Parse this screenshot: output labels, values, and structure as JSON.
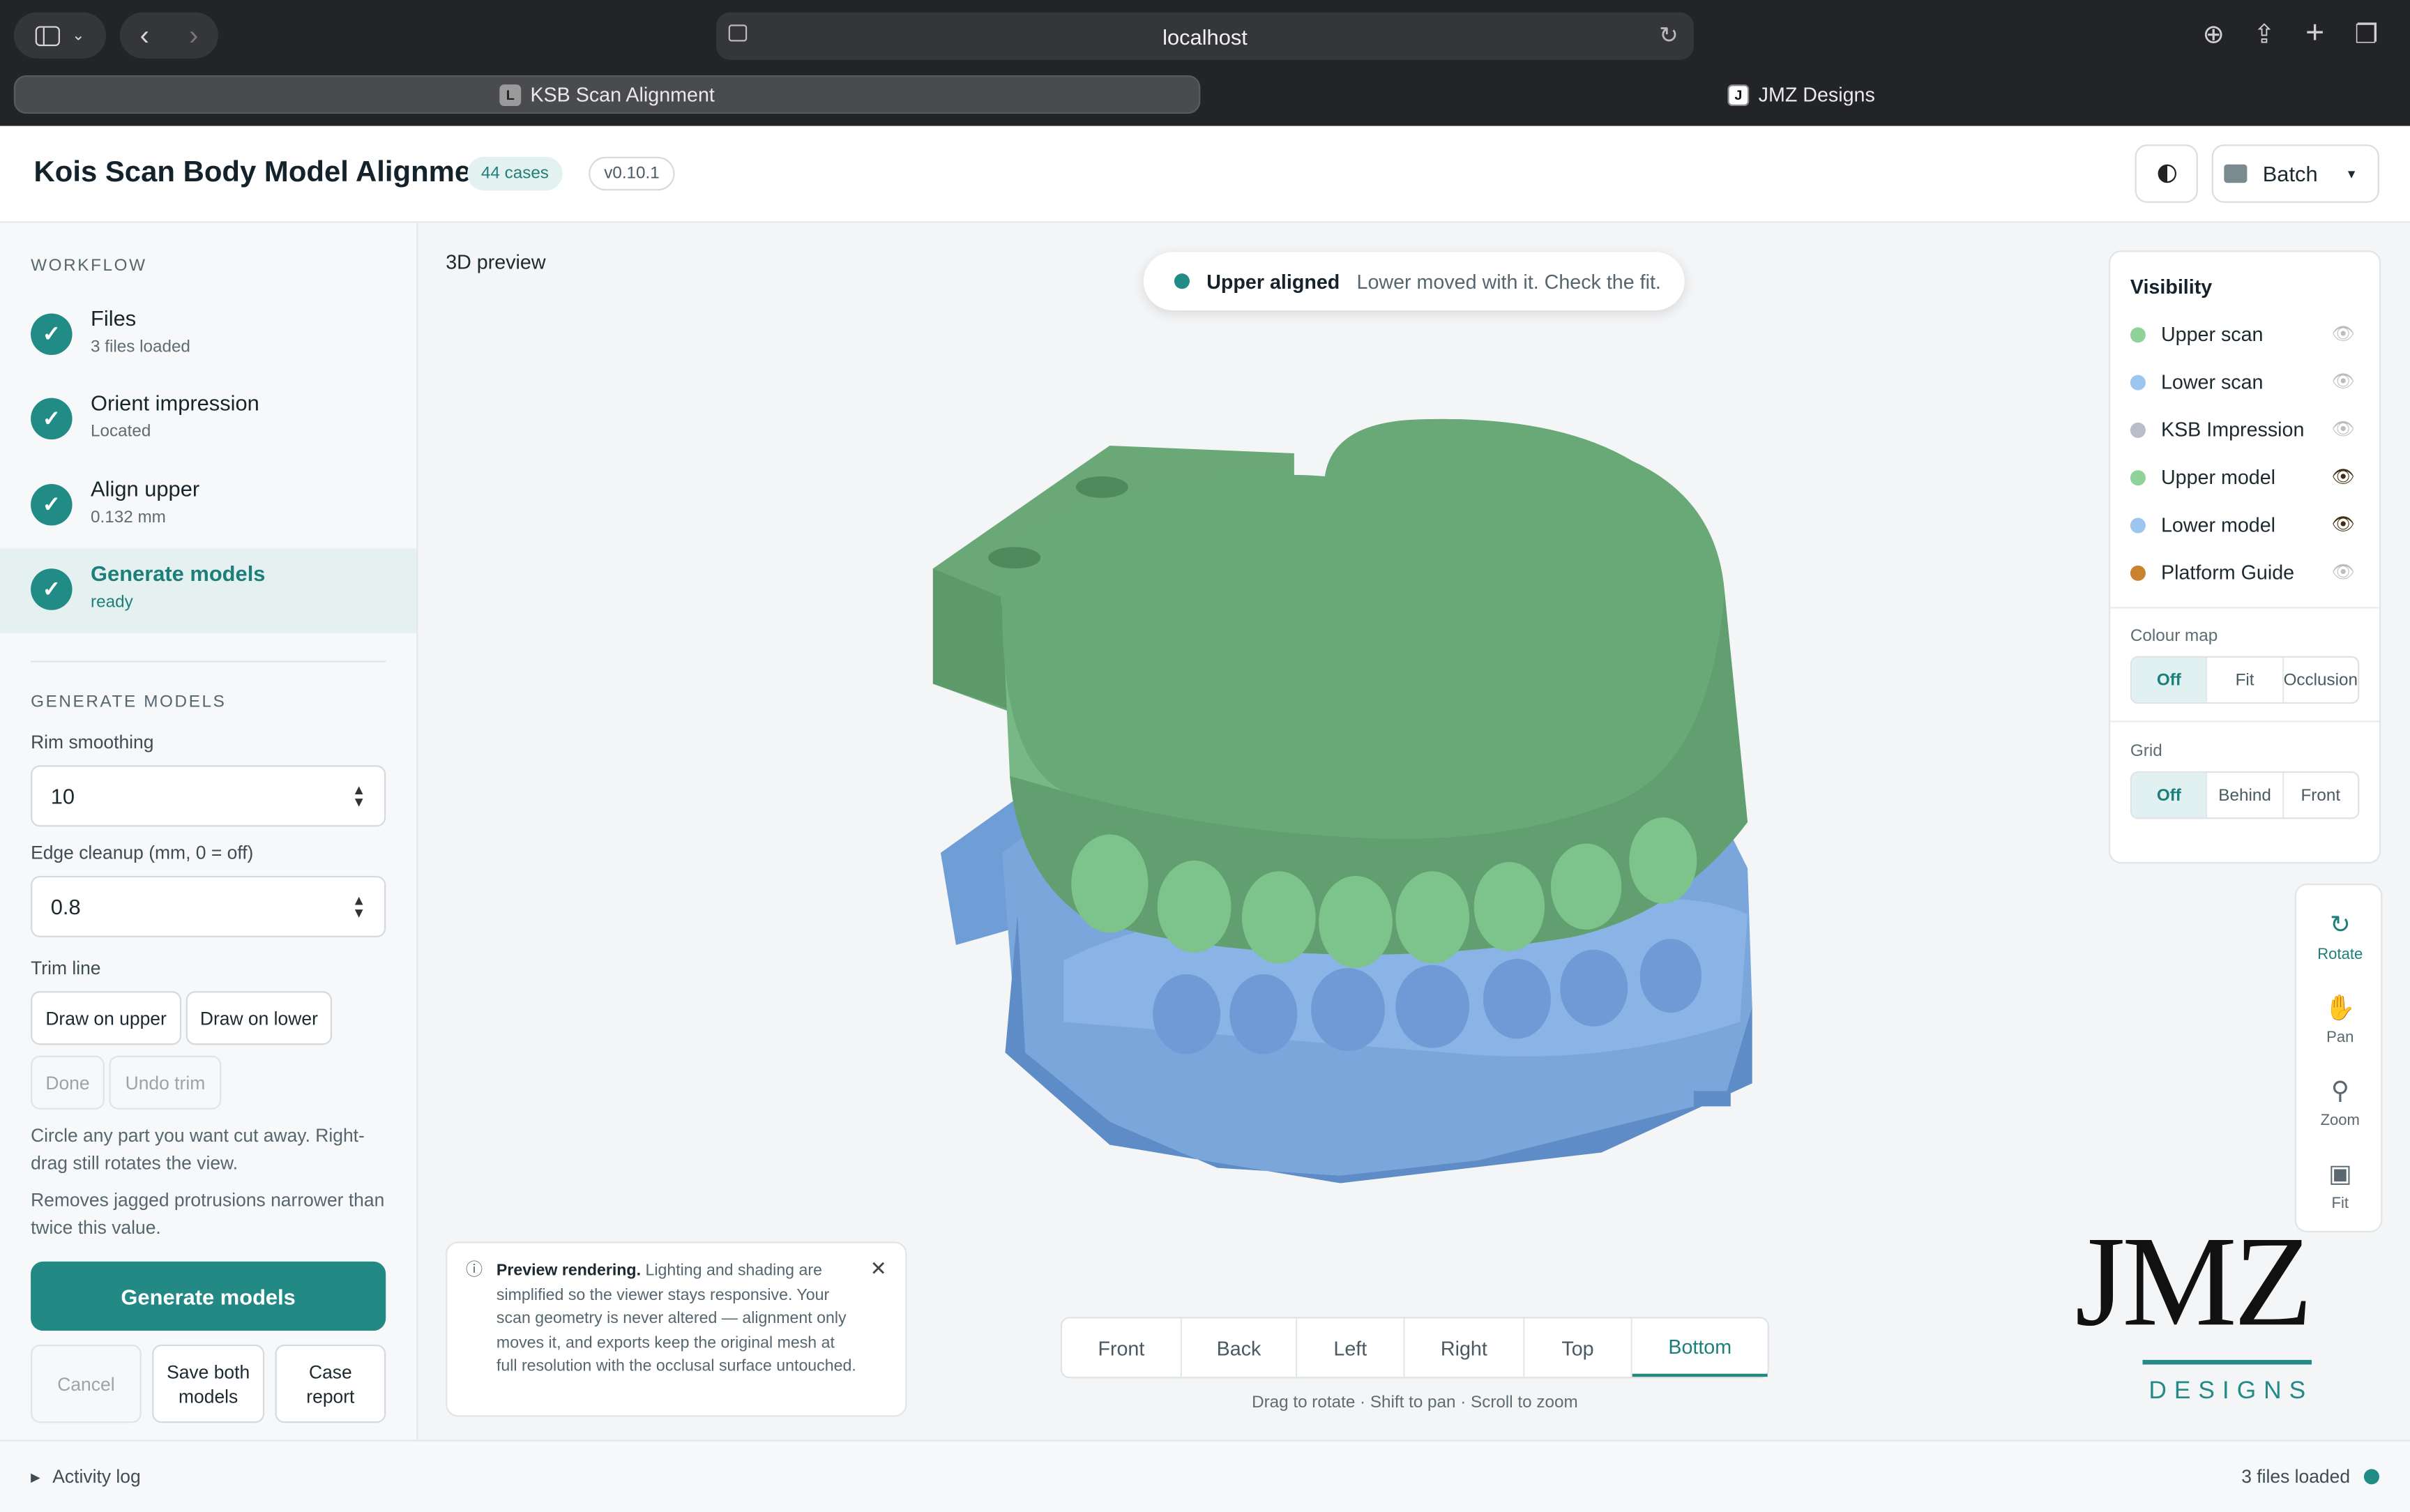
{
  "browser": {
    "url": "localhost",
    "tabs": [
      {
        "label": "KSB Scan Alignment",
        "favicon": "L",
        "active": true
      },
      {
        "label": "JMZ Designs",
        "favicon": "J",
        "active": false
      }
    ]
  },
  "header": {
    "title": "Kois Scan Body Model Alignment",
    "cases_badge": "44 cases",
    "version_badge": "v0.10.1",
    "theme_toggle_icon": "contrast-icon",
    "batch_label": "Batch"
  },
  "sidebar": {
    "workflow_heading": "WORKFLOW",
    "steps": [
      {
        "title": "Files",
        "subtitle": "3 files loaded",
        "done": true
      },
      {
        "title": "Orient impression",
        "subtitle": "Located",
        "done": true
      },
      {
        "title": "Align upper",
        "subtitle": "0.132 mm",
        "done": true
      },
      {
        "title": "Generate models",
        "subtitle": "ready",
        "done": true,
        "active": true
      }
    ],
    "generate_heading": "GENERATE MODELS",
    "rim_smoothing_label": "Rim smoothing",
    "rim_smoothing_value": "10",
    "edge_cleanup_label": "Edge cleanup (mm, 0 = off)",
    "edge_cleanup_value": "0.8",
    "trim_line_label": "Trim line",
    "draw_upper": "Draw on upper",
    "draw_lower": "Draw on lower",
    "done": "Done",
    "undo_trim": "Undo trim",
    "trim_help": "Circle any part you want cut away. Right-drag still rotates the view.",
    "edge_help": "Removes jagged protrusions narrower than twice this value.",
    "generate_button": "Generate models",
    "cancel": "Cancel",
    "save_both": "Save both models",
    "case_report": "Case report"
  },
  "viewer": {
    "label": "3D preview",
    "toast_title": "Upper aligned",
    "toast_text": "Lower moved with it. Check the fit.",
    "visibility_heading": "Visibility",
    "layers": [
      {
        "label": "Upper scan",
        "color": "#8fd39a",
        "visible": false
      },
      {
        "label": "Lower scan",
        "color": "#9cc6f0",
        "visible": false
      },
      {
        "label": "KSB Impression",
        "color": "#b8bdc9",
        "visible": false
      },
      {
        "label": "Upper model",
        "color": "#8fd39a",
        "visible": true
      },
      {
        "label": "Lower model",
        "color": "#9cc6f0",
        "visible": true
      },
      {
        "label": "Platform Guide",
        "color": "#c9822e",
        "visible": false
      }
    ],
    "colour_map_label": "Colour map",
    "colour_map_options": [
      "Off",
      "Fit",
      "Occlusion"
    ],
    "colour_map_selected": "Off",
    "grid_label": "Grid",
    "grid_options": [
      "Off",
      "Behind",
      "Front"
    ],
    "grid_selected": "Off",
    "tools": [
      {
        "label": "Rotate",
        "icon": "rotate-icon",
        "active": true
      },
      {
        "label": "Pan",
        "icon": "hand-icon",
        "active": false
      },
      {
        "label": "Zoom",
        "icon": "magnifier-icon",
        "active": false
      },
      {
        "label": "Fit",
        "icon": "fit-icon",
        "active": false
      }
    ],
    "views": [
      "Front",
      "Back",
      "Left",
      "Right",
      "Top",
      "Bottom"
    ],
    "view_selected": "Bottom",
    "hint": "Drag to rotate · Shift to pan · Scroll to zoom",
    "notice_title": "Preview rendering.",
    "notice_text": "Lighting and shading are simplified so the viewer stays responsive. Your scan geometry is never altered — alignment only moves it, and exports keep the original mesh at full resolution with the occlusal surface untouched.",
    "logo_main": "JMZ",
    "logo_sub": "DESIGNS",
    "model_colors": {
      "upper": "#6aa877",
      "lower": "#7aa6dc"
    }
  },
  "statusbar": {
    "activity_log": "Activity log",
    "files_status": "3 files loaded",
    "status_color": "#218b86"
  }
}
